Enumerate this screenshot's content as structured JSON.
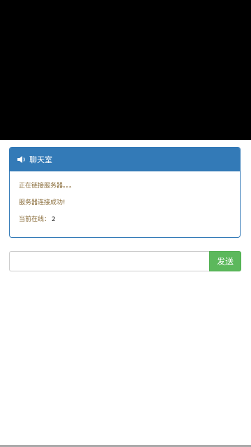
{
  "chat_panel": {
    "title": "聊天室",
    "messages": [
      "正在链接服务器。。。",
      "服务器连接成功!"
    ],
    "online_label": "当前在线：",
    "online_count": "2"
  },
  "composer": {
    "input_value": "",
    "input_placeholder": "",
    "send_label": "发送"
  },
  "colors": {
    "panel_primary": "#337ab7",
    "send_button": "#5cb85c",
    "message_text": "#8a6d3b",
    "video_background": "#000000"
  },
  "icons": {
    "panel_heading": "speaker-icon"
  }
}
